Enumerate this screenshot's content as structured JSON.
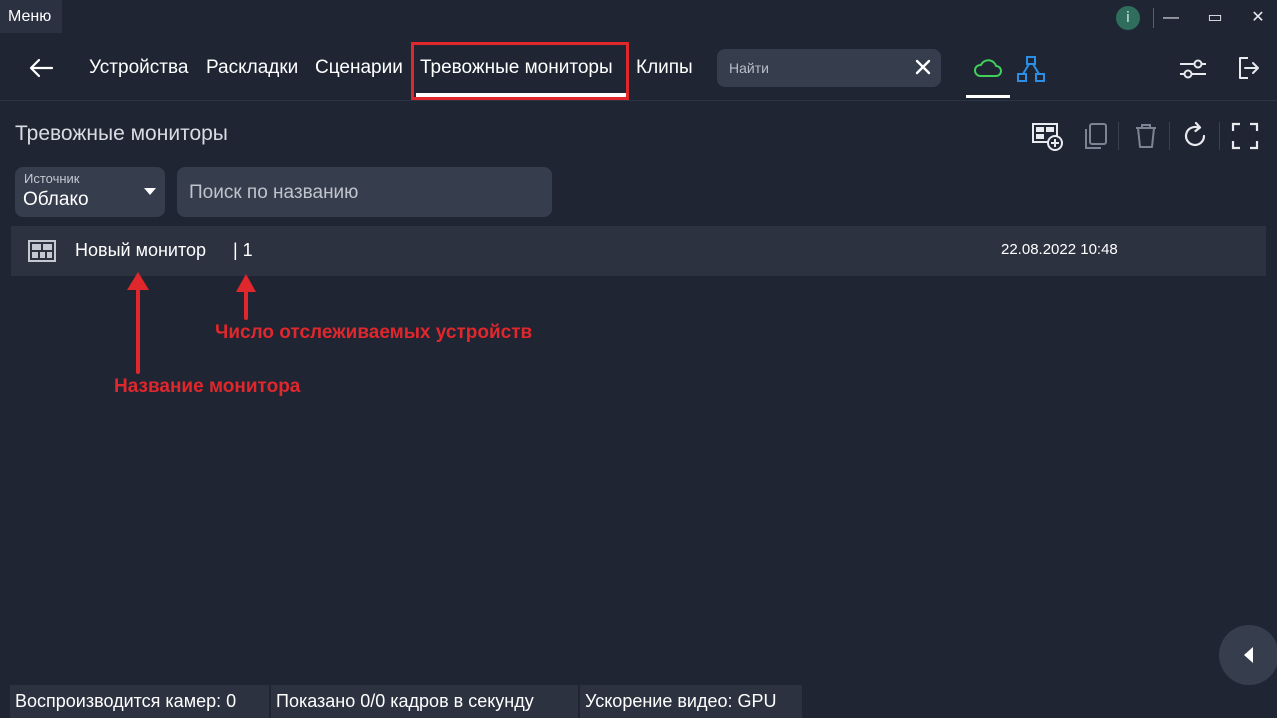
{
  "titlebar": {
    "menu_label": "Меню",
    "info_glyph": "i",
    "minimize_glyph": "—",
    "maximize_glyph": "▭",
    "close_glyph": "✕"
  },
  "nav": {
    "tabs": [
      {
        "label": "Устройства"
      },
      {
        "label": "Раскладки"
      },
      {
        "label": "Сценарии"
      },
      {
        "label": "Тревожные мониторы",
        "active": true
      },
      {
        "label": "Клипы"
      }
    ],
    "search_placeholder": "Найти",
    "icons": [
      "back-arrow-icon",
      "close-icon",
      "cloud-icon",
      "network-icon",
      "settings-sliders-icon",
      "logout-icon"
    ]
  },
  "page": {
    "title": "Тревожные мониторы",
    "toolbar_icons": [
      "add-monitor-icon",
      "copy-icon",
      "delete-icon",
      "refresh-icon",
      "fullscreen-icon"
    ]
  },
  "filters": {
    "source_label": "Источник",
    "source_value": "Облако",
    "name_search_placeholder": "Поиск по названию"
  },
  "monitors": [
    {
      "name": "Новый монитор",
      "count_text": "| 1",
      "date": "22.08.2022 10:48"
    }
  ],
  "annotations": {
    "count": "Число отслеживаемых устройств",
    "name": "Название монитора"
  },
  "status_bar": {
    "cameras": "Воспроизводится камер: 0",
    "fps": "Показано 0/0 кадров в секунду",
    "accel": "Ускорение видео: GPU"
  },
  "colors": {
    "background": "#1f2533",
    "panel": "#363d4d",
    "row": "#2c3240",
    "highlight": "#e0272c",
    "cloud_accent": "#3fcf5a",
    "network_accent": "#2a8fe6"
  }
}
